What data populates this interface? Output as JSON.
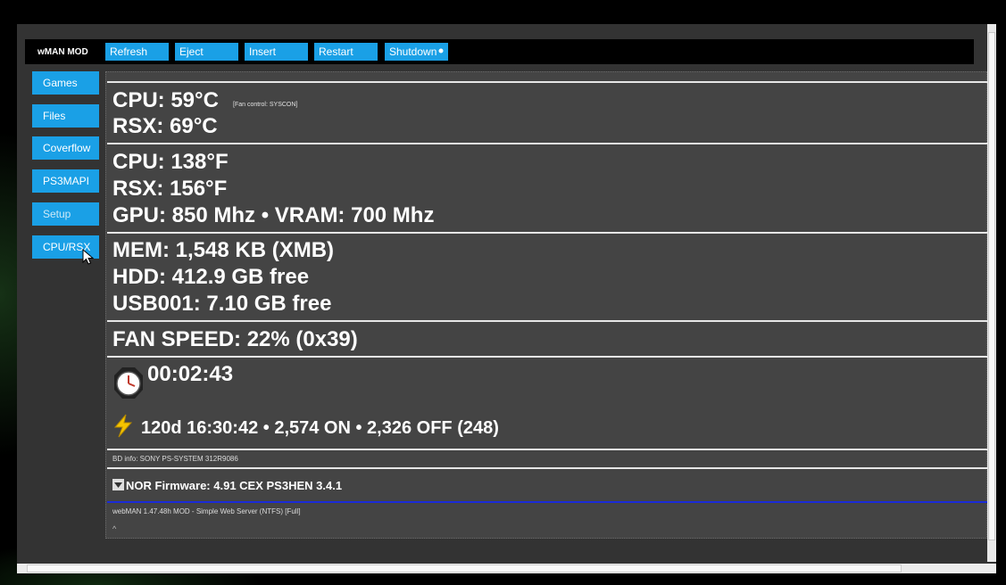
{
  "topbar": {
    "brand": "wMAN MOD",
    "buttons": [
      "Refresh",
      "Eject",
      "Insert",
      "Restart",
      "Shutdown"
    ]
  },
  "sidebar": {
    "items": [
      "Games",
      "Files",
      "Coverflow",
      "PS3MAPI",
      "Setup",
      "CPU/RSX"
    ]
  },
  "temps": {
    "cpu_c": "CPU: 59°C",
    "fan_control": "[Fan control: SYSCON]",
    "rsx_c": "RSX: 69°C",
    "cpu_f": "CPU: 138°F",
    "rsx_f": "RSX: 156°F",
    "gpu_vram": "GPU: 850 Mhz • VRAM: 700 Mhz"
  },
  "storage": {
    "mem": "MEM: 1,548 KB (XMB)",
    "hdd": "HDD: 412.9 GB free",
    "usb": "USB001: 7.10 GB free"
  },
  "fan": {
    "speed": "FAN SPEED: 22% (0x39)"
  },
  "uptime": {
    "session": "00:02:43",
    "total": "120d 16:30:42 • 2,574 ON • 2,326 OFF (248)"
  },
  "bd_info": "BD info: SONY PS-SYSTEM 312R9086",
  "nor_firmware": "NOR Firmware: 4.91 CEX PS3HEN 3.4.1",
  "footer": "webMAN 1.47.48h MOD - Simple Web Server (NTFS) [Full]",
  "icons": {
    "clock": "clock-icon",
    "bolt": "lightning-icon",
    "dropdown": "dropdown-arrow-icon",
    "scroll_up": "caret-up-icon"
  },
  "colors": {
    "accent": "#1aa0e6",
    "panel": "#444444",
    "bolt": "#f5c400",
    "divider_blue": "#1a2bd8"
  }
}
